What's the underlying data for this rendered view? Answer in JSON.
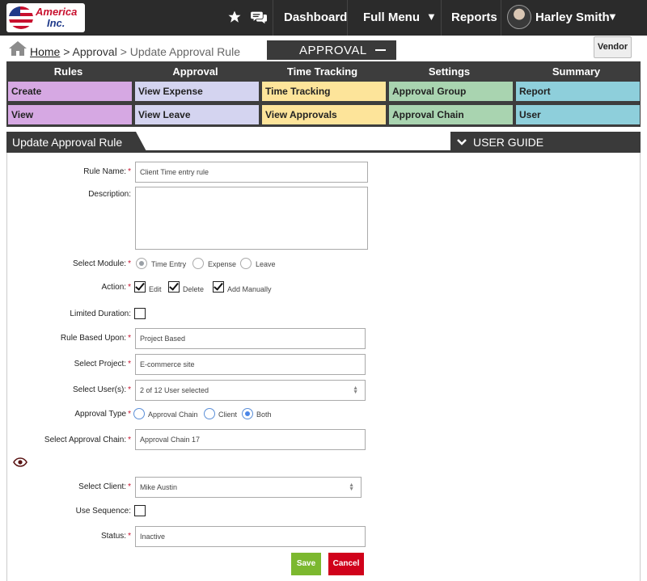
{
  "header": {
    "logo_line1": "America",
    "logo_line2": "Inc.",
    "nav": {
      "dashboard": "Dashboard",
      "full_menu": "Full Menu",
      "reports": "Reports"
    },
    "user_name": "Harley Smith"
  },
  "breadcrumb": {
    "home": "Home",
    "sep1": " > ",
    "approval": "Approval",
    "sep2": " > ",
    "current": "Update Approval Rule"
  },
  "module_tab": "APPROVAL",
  "vendor_button": "Vendor",
  "menu": {
    "columns": [
      {
        "head": "Rules",
        "items": [
          "Create",
          "View"
        ],
        "color": "#d6a8e3"
      },
      {
        "head": "Approval",
        "items": [
          "View Expense",
          "View Leave"
        ],
        "color": "#d4d4f0"
      },
      {
        "head": "Time Tracking",
        "items": [
          "Time Tracking",
          "View Approvals"
        ],
        "color": "#fde49a"
      },
      {
        "head": "Settings",
        "items": [
          "Approval Group",
          "Approval Chain"
        ],
        "color": "#a9d4b0"
      },
      {
        "head": "Summary",
        "items": [
          "Report",
          "User"
        ],
        "color": "#8ecfdb"
      }
    ]
  },
  "section": {
    "title": "Update Approval Rule",
    "guide": "USER GUIDE"
  },
  "form": {
    "rule_name": {
      "label": "Rule Name:",
      "value": "Client Time entry rule"
    },
    "description": {
      "label": "Description:",
      "value": ""
    },
    "module": {
      "label": "Select Module:",
      "options": [
        "Time Entry",
        "Expense",
        "Leave"
      ],
      "selected": "Time Entry"
    },
    "action": {
      "label": "Action:",
      "options": [
        "Edit",
        "Delete",
        "Add Manually"
      ],
      "checked": [
        true,
        true,
        true
      ]
    },
    "limited_duration": {
      "label": "Limited Duration:",
      "checked": false
    },
    "rule_based_upon": {
      "label": "Rule Based Upon:",
      "value": "Project Based"
    },
    "project": {
      "label": "Select Project:",
      "value": "E-commerce site"
    },
    "users": {
      "label": "Select User(s):",
      "value": "2 of 12 User selected"
    },
    "approval_type": {
      "label": "Approval Type",
      "options": [
        "Approval Chain",
        "Client",
        "Both"
      ],
      "selected": "Both"
    },
    "approval_chain": {
      "label": "Select Approval Chain:",
      "value": "Approval Chain 17"
    },
    "client": {
      "label": "Select Client:",
      "value": "Mike Austin"
    },
    "use_sequence": {
      "label": "Use Sequence:",
      "checked": false
    },
    "status": {
      "label": "Status:",
      "value": "Inactive"
    },
    "required_mark": "*",
    "save": "Save",
    "cancel": "Cancel"
  },
  "colors": {
    "topbar": "#2b2b2b",
    "save": "#7cb82f",
    "cancel": "#d0021b",
    "required": "#c8102e"
  }
}
